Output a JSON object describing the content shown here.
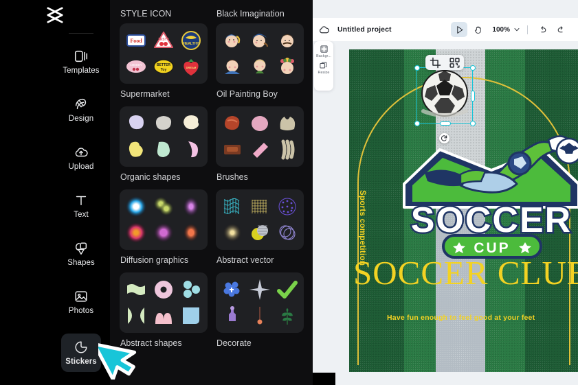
{
  "app": {
    "logo_icon": "capcut-logo-icon"
  },
  "sidebar": {
    "items": [
      {
        "label": "Templates",
        "icon": "templates-icon",
        "active": false
      },
      {
        "label": "Design",
        "icon": "design-icon",
        "active": false
      },
      {
        "label": "Upload",
        "icon": "upload-cloud-icon",
        "active": false
      },
      {
        "label": "Text",
        "icon": "text-icon",
        "active": false
      },
      {
        "label": "Shapes",
        "icon": "shapes-icon",
        "active": false
      },
      {
        "label": "Photos",
        "icon": "photos-icon",
        "active": false
      },
      {
        "label": "Stickers",
        "icon": "sticker-icon",
        "active": true
      }
    ]
  },
  "sticker_panel": {
    "categories": [
      {
        "title": "STYLE ICON",
        "label": "Supermarket",
        "title_is_header": true
      },
      {
        "title": "Black Imagination",
        "label": "Oil Painting Boy",
        "title_is_header": false
      },
      {
        "title": "",
        "label": "Organic shapes",
        "title_is_header": false
      },
      {
        "title": "",
        "label": "Brushes",
        "title_is_header": false
      },
      {
        "title": "",
        "label": "Diffusion graphics",
        "title_is_header": false
      },
      {
        "title": "",
        "label": "Abstract vector",
        "title_is_header": false
      },
      {
        "title": "",
        "label": "Abstract shapes",
        "title_is_header": false
      },
      {
        "title": "",
        "label": "Decorate",
        "title_is_header": false
      }
    ]
  },
  "editor": {
    "topbar": {
      "cloud_icon": "cloud-save-icon",
      "project_name": "Untitled project",
      "select_tool_icon": "select-cursor-icon",
      "hand_tool_icon": "hand-tool-icon",
      "zoom_level": "100%",
      "zoom_caret_icon": "chevron-down-icon",
      "undo_icon": "undo-icon",
      "redo_icon": "redo-icon"
    },
    "float_tools": [
      {
        "label": "Backgr...",
        "icon": "background-checker-icon"
      },
      {
        "label": "Resize",
        "icon": "resize-frame-icon"
      }
    ],
    "object_toolbar": [
      {
        "icon": "crop-icon"
      },
      {
        "icon": "remove-background-icon"
      }
    ],
    "rotate_handle_icon": "rotate-icon",
    "selected_object": "soccer-ball-sticker"
  },
  "poster": {
    "vertical_text": "Sports competition",
    "badge_main": "SOCCER",
    "badge_sub": "CUP",
    "big_title": "SOCCER CLUB",
    "tagline": "Have fun enough to feel good at your feet"
  },
  "colors": {
    "accent_cyan": "#18c5d8",
    "poster_yellow": "#f3d223",
    "turf_dark": "#1d5b34",
    "turf_light": "#2a7a44",
    "panel_bg": "#0e0e10",
    "card_bg": "#1f2023",
    "editor_bg": "#eef1f4"
  },
  "cursor": {
    "icon": "mouse-pointer-cursor"
  }
}
